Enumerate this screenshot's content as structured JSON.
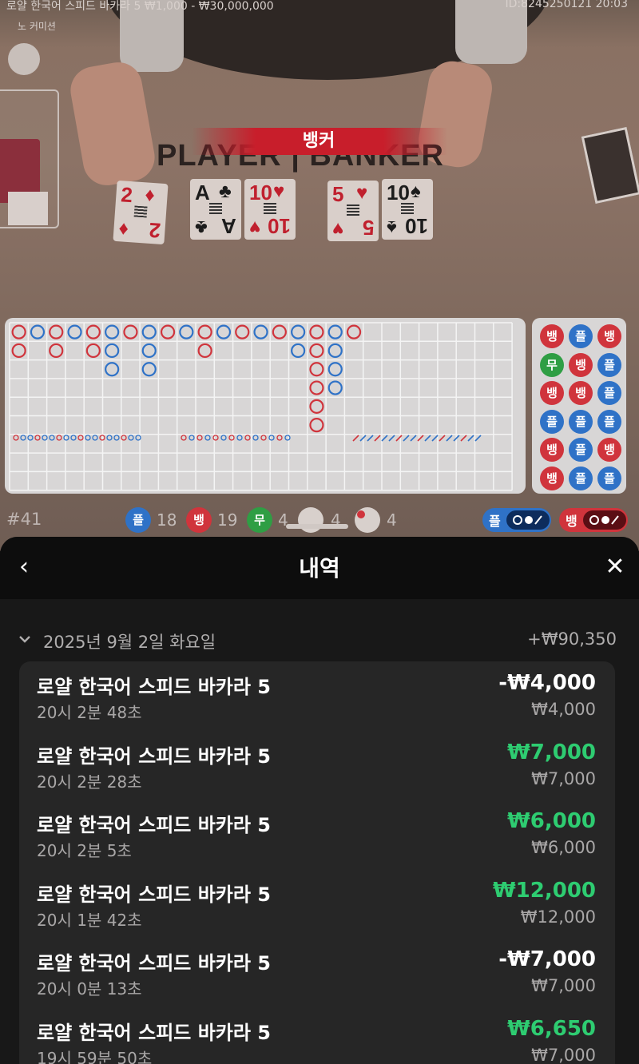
{
  "video": {
    "table_info": "로얄 한국어 스피드 바카라 5  ₩1,000 - ₩30,000,000",
    "session_id_time": "ID:8245250121  20:03",
    "commission": "노 커미션",
    "table_label": "PLAYER | BANKER",
    "result_banner": "뱅커",
    "player_cards": [
      {
        "rank": "2",
        "suit": "♦",
        "color": "red"
      },
      {
        "rank": "A",
        "suit": "♣",
        "color": "black"
      },
      {
        "rank": "10",
        "suit": "♥",
        "color": "red"
      }
    ],
    "banker_cards": [
      {
        "rank": "5",
        "suit": "♥",
        "color": "red"
      },
      {
        "rank": "10",
        "suit": "♠",
        "color": "black"
      }
    ]
  },
  "bead_road": [
    [
      "뱅",
      "플",
      "뱅"
    ],
    [
      "무",
      "뱅",
      "플"
    ],
    [
      "뱅",
      "뱅",
      "플"
    ],
    [
      "플",
      "플",
      "플"
    ],
    [
      "뱅",
      "플",
      "뱅"
    ],
    [
      "뱅",
      "플",
      "플"
    ]
  ],
  "colors": {
    "player": "#2f72c7",
    "banker": "#d0343c",
    "tie": "#2f9e44",
    "win": "#2ecc71"
  },
  "stats": {
    "shoe": "#41",
    "player_label": "플",
    "player_count": "18",
    "banker_label": "뱅",
    "banker_count": "19",
    "tie_label": "무",
    "tie_count": "4",
    "ppair_count": "4",
    "bpair_count": "4",
    "ask_player": "플",
    "ask_banker": "뱅"
  },
  "sheet": {
    "title": "내역",
    "back_icon": "‹",
    "close_icon": "✕",
    "date": "2025년 9월 2일 화요일",
    "date_total": "+₩90,350",
    "rows": [
      {
        "title": "로얄 한국어 스피드 바카라 5",
        "time": "20시 2분 48초",
        "amount": "-₩4,000",
        "bet": "₩4,000",
        "win": false
      },
      {
        "title": "로얄 한국어 스피드 바카라 5",
        "time": "20시 2분 28초",
        "amount": "₩7,000",
        "bet": "₩7,000",
        "win": true
      },
      {
        "title": "로얄 한국어 스피드 바카라 5",
        "time": "20시 2분 5초",
        "amount": "₩6,000",
        "bet": "₩6,000",
        "win": true
      },
      {
        "title": "로얄 한국어 스피드 바카라 5",
        "time": "20시 1분 42초",
        "amount": "₩12,000",
        "bet": "₩12,000",
        "win": true
      },
      {
        "title": "로얄 한국어 스피드 바카라 5",
        "time": "20시 0분 13초",
        "amount": "-₩7,000",
        "bet": "₩7,000",
        "win": false
      },
      {
        "title": "로얄 한국어 스피드 바카라 5",
        "time": "19시 59분 50초",
        "amount": "₩6,650",
        "bet": "₩7,000",
        "win": true
      }
    ]
  }
}
